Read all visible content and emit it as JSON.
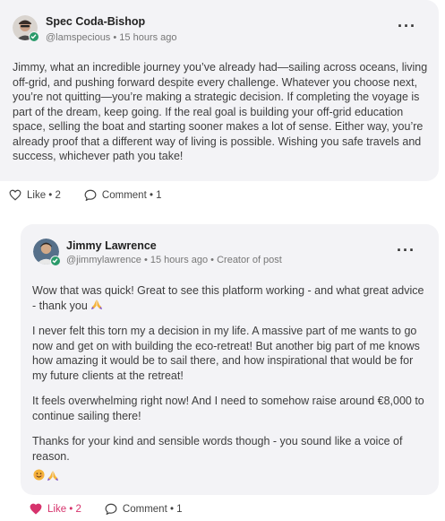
{
  "post": {
    "author": "Spec Coda-Bishop",
    "handle": "@lamspecious",
    "time": "15 hours ago",
    "body": "Jimmy, what an incredible journey you’ve already had—sailing across oceans, living off-grid, and pushing forward despite every challenge. Whatever you choose next, you’re not quitting—you’re making a strategic decision. If completing the voyage is part of the dream, keep going. If the real goal is building your off-grid education space, selling the boat and starting sooner makes a lot of sense. Either way, you’re already proof that a different way of living is possible. Wishing you safe travels and success, whichever path you take!",
    "like_label": "Like • 2",
    "comment_label": "Comment • 1"
  },
  "reply": {
    "author": "Jimmy Lawrence",
    "handle": "@jimmylawrence",
    "time": "15 hours ago",
    "role": "Creator of post",
    "paragraphs": [
      "Wow that was quick! Great to see this platform working - and what great advice - thank you",
      "I never felt this torn my a decision in my life. A massive part of me wants to go now and get on with building the eco-retreat! But another big part of me knows how amazing it would be to sail there, and how inspirational that would be for my future clients at the retreat!",
      "It feels overwhelming right now! And I need to somehow raise around €8,000 to continue sailing there!",
      "Thanks for your kind and sensible words though - you sound like a voice of reason."
    ],
    "like_label": "Like • 2",
    "comment_label": "Comment • 1",
    "liked": true
  },
  "colors": {
    "card_bg": "#f3f3f6",
    "liked": "#d6336c",
    "verified": "#2a9a6a"
  },
  "icons": [
    "verified-badge-icon",
    "more-options-icon",
    "heart-icon",
    "comment-icon",
    "pray-hands-emoji",
    "smile-emoji"
  ]
}
